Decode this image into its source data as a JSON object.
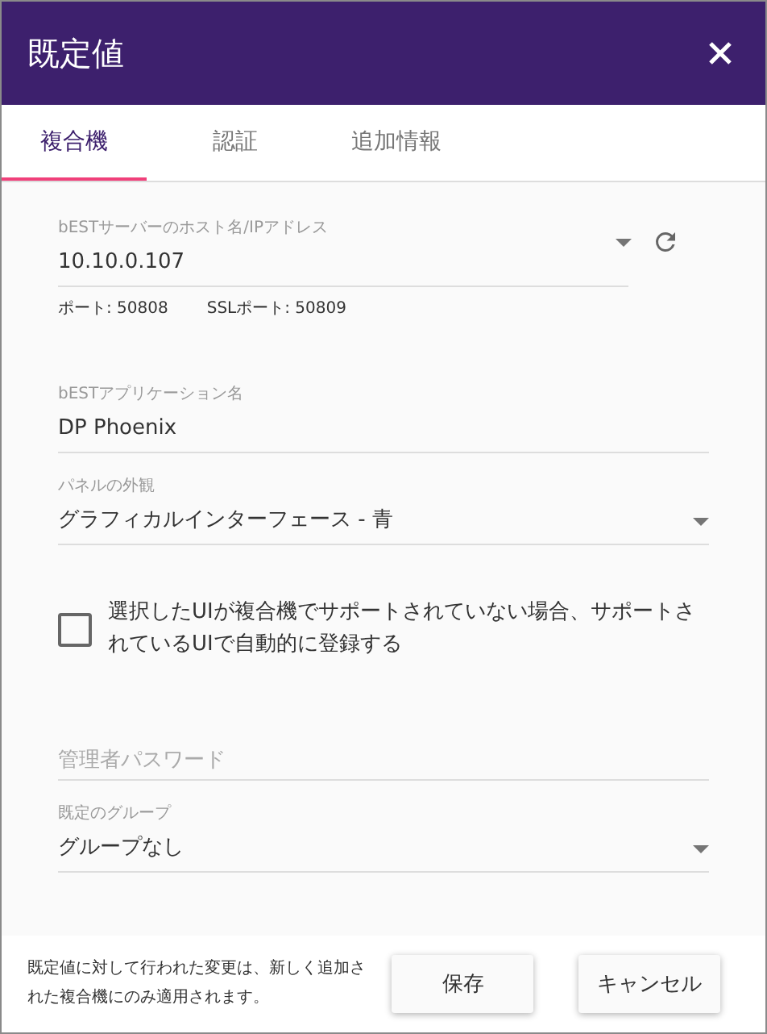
{
  "dialog": {
    "title": "既定値"
  },
  "tabs": [
    {
      "label": "複合機",
      "selected": true
    },
    {
      "label": "認証",
      "selected": false
    },
    {
      "label": "追加情報",
      "selected": false
    }
  ],
  "host": {
    "label": "bESTサーバーのホスト名/IPアドレス",
    "value": "10.10.0.107",
    "ports": [
      "ポート: 50808",
      "SSLポート: 50809"
    ]
  },
  "fields": [
    {
      "kind": "text",
      "label": "bESTアプリケーション名",
      "value": "DP Phoenix"
    },
    {
      "kind": "select",
      "label": "パネルの外観",
      "value": "グラフィカルインターフェース - 青"
    },
    {
      "kind": "checkbox",
      "label": "選択したUIが複合機でサポートされていない場合、サポートされているUIで自動的に登録する",
      "checked": false
    },
    {
      "kind": "password",
      "placeholder": "管理者パスワード"
    },
    {
      "kind": "select",
      "label": "既定のグループ",
      "value": "グループなし"
    }
  ],
  "footer": {
    "note": "既定値に対して行われた変更は、新しく追加された複合機にのみ適用されます。",
    "buttons": [
      "保存",
      "キャンセル"
    ]
  }
}
